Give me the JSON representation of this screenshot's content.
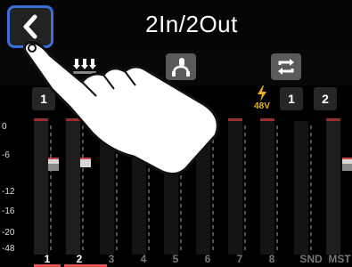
{
  "header": {
    "title": "2In/2Out",
    "back_icon": "chevron-left-icon"
  },
  "toolbar": {
    "buttons": [
      {
        "name": "routing-icon"
      },
      {
        "name": "headphone-mic-icon"
      },
      {
        "name": "loop-icon"
      }
    ]
  },
  "mixer": {
    "top_channels": [
      "1",
      "1",
      "2"
    ],
    "phantom_label": "48V",
    "scale": [
      "0",
      "-6",
      "-12",
      "-16",
      "-20",
      "-48"
    ],
    "channels": [
      {
        "label": "1",
        "active": true
      },
      {
        "label": "2",
        "active": true
      },
      {
        "label": "3",
        "active": false
      },
      {
        "label": "4",
        "active": false
      },
      {
        "label": "5",
        "active": false
      },
      {
        "label": "6",
        "active": false
      },
      {
        "label": "7",
        "active": false
      },
      {
        "label": "8",
        "active": false
      },
      {
        "label": "SND",
        "active": false
      },
      {
        "label": "MST",
        "active": false
      }
    ]
  },
  "colors": {
    "accent_blue": "#3a6fd8",
    "channel_red": "#e2524f",
    "phantom_yellow": "#e9b21c"
  }
}
